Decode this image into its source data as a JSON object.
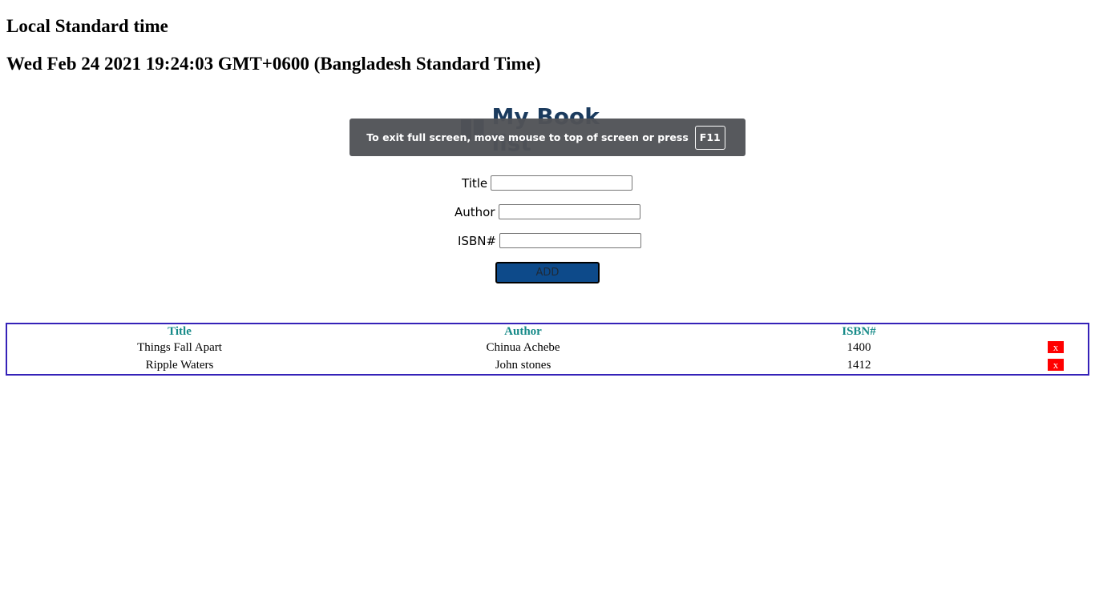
{
  "header": {
    "title": "Local Standard time",
    "datetime": "Wed Feb 24 2021 19:24:03 GMT+0600 (Bangladesh Standard Time)"
  },
  "app": {
    "logo_text": "My Book list",
    "logo_color": "#1b3b5e"
  },
  "fullscreen_notice": {
    "text": "To exit full screen, move mouse to top of screen or press",
    "key": "F11"
  },
  "form": {
    "title_label": "Title",
    "title_value": "",
    "author_label": "Author",
    "author_value": "",
    "isbn_label": "ISBN#",
    "isbn_value": "",
    "add_label": "ADD",
    "add_color": "#0d4a8a"
  },
  "table": {
    "headers": [
      "Title",
      "Author",
      "ISBN#"
    ],
    "header_color": "#168a88",
    "border_color": "#3522b8",
    "rows": [
      {
        "title": "Things Fall Apart",
        "author": "Chinua Achebe",
        "isbn": "1400",
        "delete_label": "x"
      },
      {
        "title": "Ripple Waters",
        "author": "John stones",
        "isbn": "1412",
        "delete_label": "x"
      }
    ],
    "delete_color": "#ff0000"
  }
}
